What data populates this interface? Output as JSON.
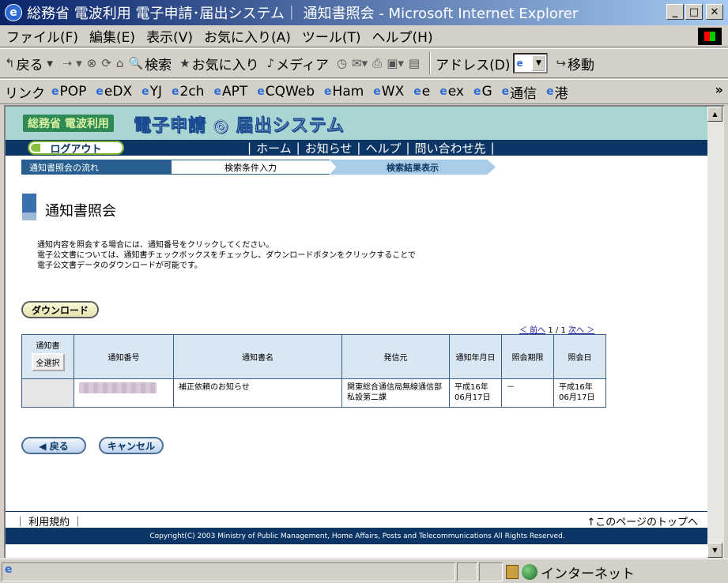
{
  "window": {
    "title": "総務省 電波利用 電子申請･届出システム｜ 通知書照会 - Microsoft Internet Explorer"
  },
  "menu": [
    "ファイル(F)",
    "編集(E)",
    "表示(V)",
    "お気に入り(A)",
    "ツール(T)",
    "ヘルプ(H)"
  ],
  "toolbar": {
    "back": "戻る",
    "search": "検索",
    "favorites": "お気に入り",
    "media": "メディア",
    "address_label": "アドレス(D)",
    "go": "移動"
  },
  "links_bar": {
    "label": "リンク",
    "items": [
      "POP",
      "eDX",
      "YJ",
      "2ch",
      "APT",
      "CQWeb",
      "Ham",
      "WX",
      "e",
      "ex",
      "G",
      "通信",
      "港"
    ]
  },
  "site": {
    "logo_small": "総務省 電波利用",
    "logo_big": "電子申請 ◎ 届出システム",
    "logout": "ログアウト",
    "nav": [
      "ホーム",
      "お知らせ",
      "ヘルプ",
      "問い合わせ先"
    ]
  },
  "flow": {
    "label": "通知書照会の流れ",
    "step1": "検索条件入力",
    "step2": "検索結果表示"
  },
  "page": {
    "title": "通知書照会",
    "description": [
      "通知内容を照会する場合には、通知番号をクリックしてください。",
      "電子公文書については、通知書チェックボックスをチェックし、ダウンロードボタンをクリックすることで",
      "電子公文書データのダウンロードが可能です。"
    ],
    "download_button": "ダウンロード"
  },
  "pager": {
    "prev": "＜ 前へ",
    "current": "1 / 1",
    "next": "次へ ＞"
  },
  "table": {
    "headers": [
      "通知書",
      "通知番号",
      "通知書名",
      "発信元",
      "通知年月日",
      "照会期限",
      "照会日"
    ],
    "select_all": "全選択",
    "rows": [
      {
        "notice_name": "補正依頼のお知らせ",
        "sender": "関東総合通信局無線通信部私設第二課",
        "notice_date": "平成16年 06月17日",
        "deadline": "－",
        "inquiry_date": "平成16年 06月17日"
      }
    ]
  },
  "buttons": {
    "back": "◀ 戻る",
    "cancel": "キャンセル"
  },
  "footer": {
    "terms": "｜ 利用規約 ｜",
    "to_top": "↑このページのトップへ",
    "copyright": "Copyright(C) 2003 Ministry of Public Management, Home Affairs, Posts and Telecommunications All Rights Reserved."
  },
  "status": {
    "zone": "インターネット"
  }
}
